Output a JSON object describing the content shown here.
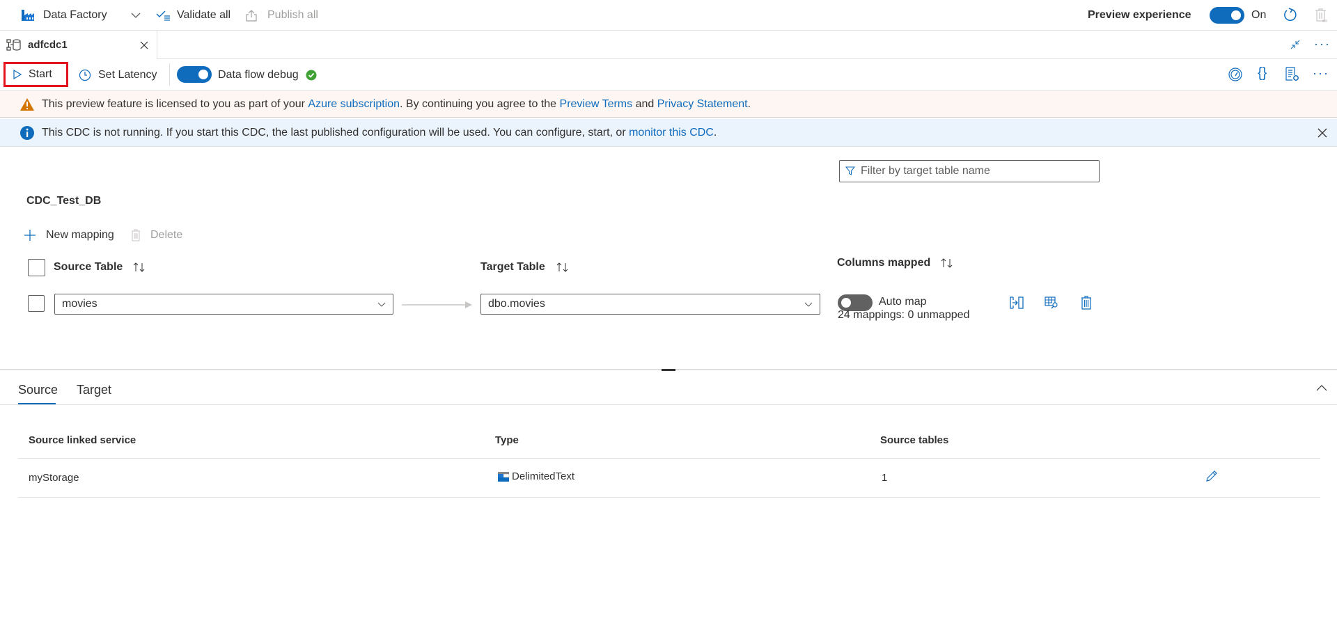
{
  "topbar": {
    "app_name": "Data Factory",
    "validate_all": "Validate all",
    "publish_all": "Publish all",
    "preview_label": "Preview experience",
    "preview_toggle_state": "On",
    "preview_toggle_on": true
  },
  "tab": {
    "name": "adfcdc1"
  },
  "toolbar": {
    "start": "Start",
    "set_latency": "Set Latency",
    "debug_label": "Data flow debug",
    "debug_on": true
  },
  "warning_banner": {
    "text_1": "This preview feature is licensed to you as part of your ",
    "link_1": "Azure subscription",
    "text_2": ". By continuing you agree to the ",
    "link_2": "Preview Terms",
    "text_3": " and ",
    "link_3": "Privacy Statement",
    "text_4": "."
  },
  "info_banner": {
    "text": "This CDC is not running. If you start this CDC, the last published configuration will be used. You can configure, start, or ",
    "link": "monitor this CDC",
    "suffix": "."
  },
  "mapping": {
    "filter_placeholder": "Filter by target table name",
    "db_title": "CDC_Test_DB",
    "new_mapping": "New mapping",
    "delete": "Delete",
    "headers": {
      "source": "Source Table",
      "target": "Target Table",
      "columns": "Columns mapped"
    },
    "rows": [
      {
        "source": "movies",
        "target": "dbo.movies",
        "auto_map_label": "Auto map",
        "auto_map_on": false,
        "summary": "24 mappings: 0 unmapped"
      }
    ]
  },
  "bottom": {
    "tabs": [
      {
        "label": "Source",
        "active": true
      },
      {
        "label": "Target",
        "active": false
      }
    ],
    "table": {
      "headers": [
        "Source linked service",
        "Type",
        "Source tables"
      ],
      "rows": [
        {
          "service": "myStorage",
          "type": "DelimitedText",
          "tables": "1"
        }
      ]
    }
  }
}
